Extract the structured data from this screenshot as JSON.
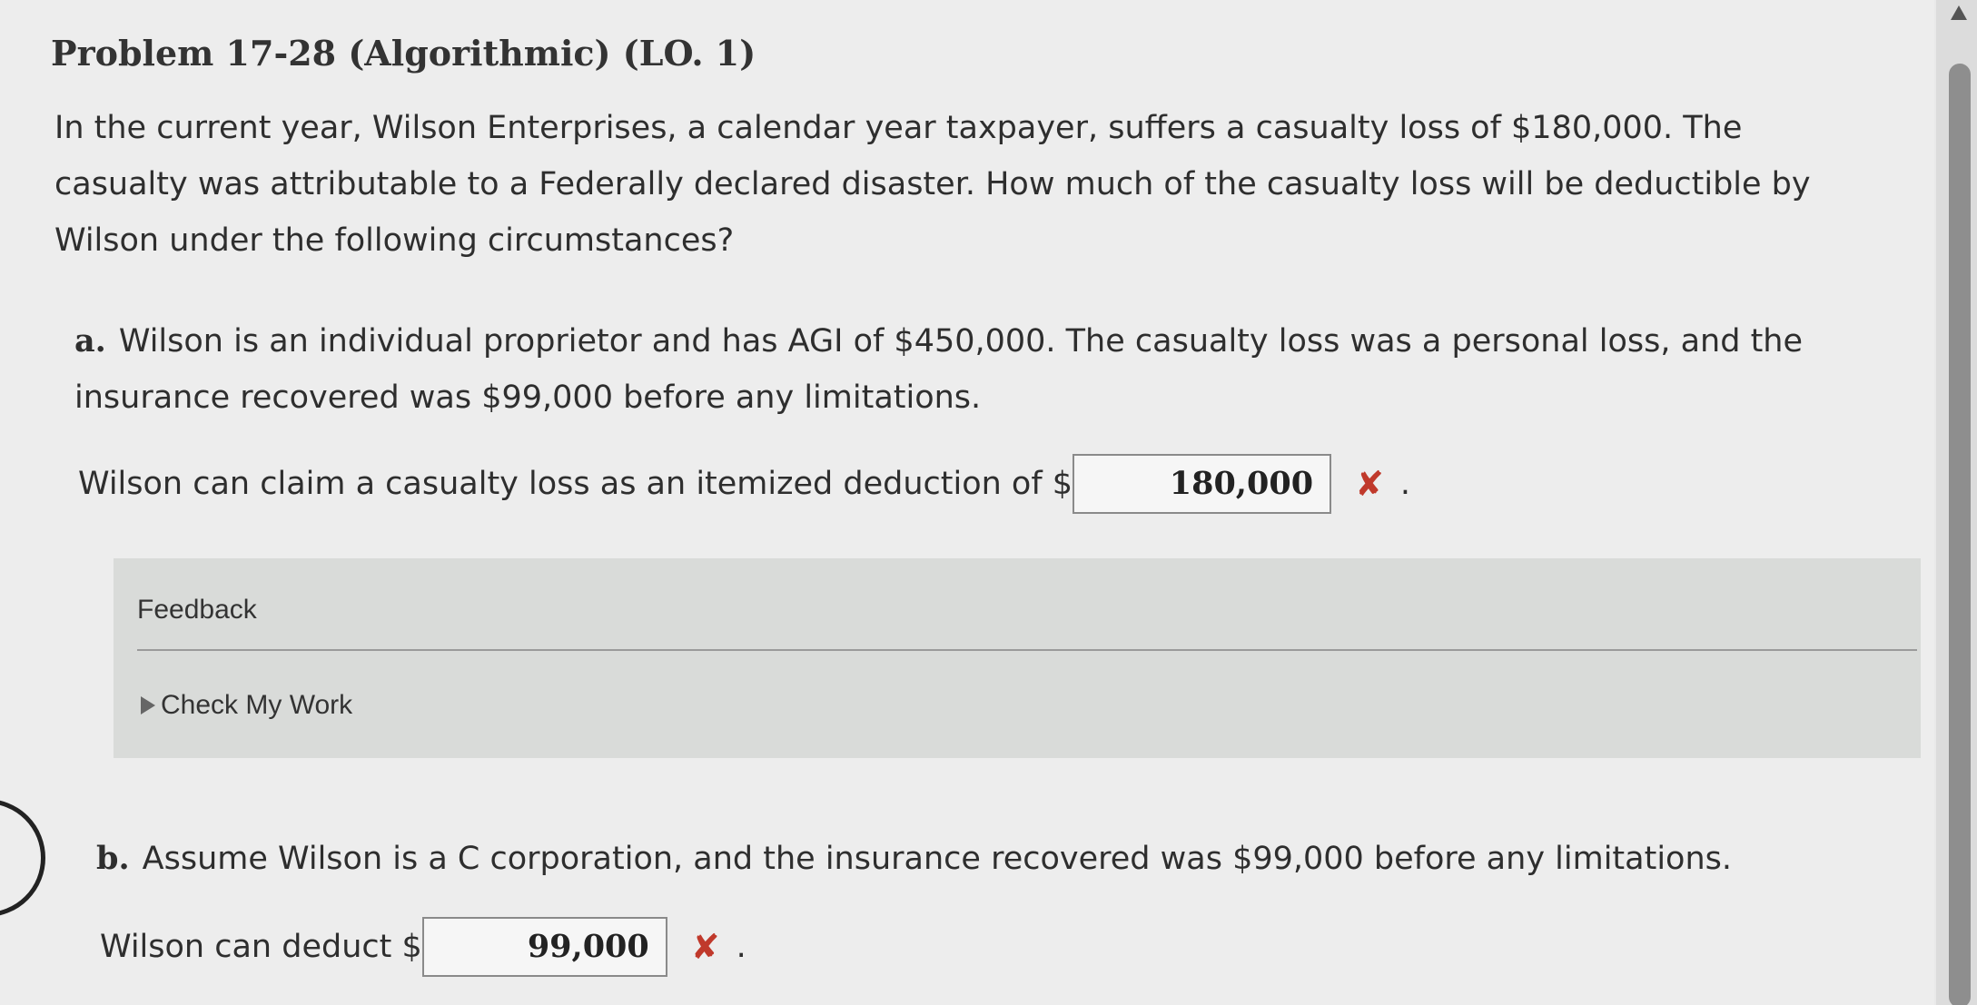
{
  "problem": {
    "title": "Problem 17-28 (Algorithmic) (LO. 1)",
    "intro": "In the current year, Wilson Enterprises, a calendar year taxpayer, suffers a casualty loss of $180,000. The casualty was attributable to a Federally declared disaster. How much of the casualty loss will be deductible by Wilson under the following circumstances?"
  },
  "part_a": {
    "label": "a.",
    "text": "Wilson is an individual proprietor and has AGI of $450,000. The casualty loss was a personal loss, and the insurance recovered was $99,000 before any limitations.",
    "prompt": "Wilson can claim a casualty loss as an itemized deduction of $",
    "answer": "180,000",
    "status_mark": "✘",
    "period": "."
  },
  "feedback": {
    "title": "Feedback",
    "check_label": "Check My Work"
  },
  "part_b": {
    "label": "b.",
    "text": "Assume Wilson is a C corporation, and the insurance recovered was $99,000 before any limitations.",
    "prompt": "Wilson can deduct $",
    "answer": "99,000",
    "status_mark": "✘",
    "period": "."
  },
  "colors": {
    "incorrect": "#c0392b",
    "feedback_bg": "#d9dbd9"
  }
}
